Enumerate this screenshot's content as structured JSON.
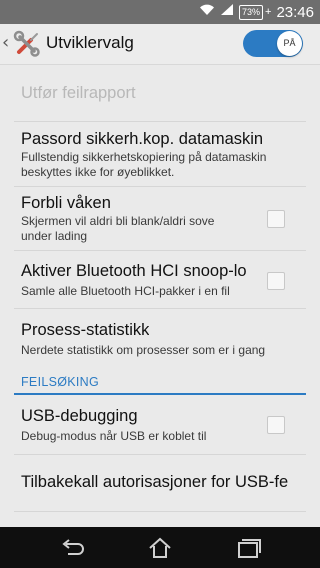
{
  "status_bar": {
    "battery": "73%",
    "time": "23:46"
  },
  "action_bar": {
    "title": "Utviklervalg",
    "toggle_label": "PÅ"
  },
  "items": [
    {
      "title": "Utfør feilrapport",
      "enabled": false
    },
    {
      "title": "Passord sikkerh.kop. datamaskin",
      "subtitle": "Fullstendig sikkerhetskopiering på datamaskin beskyttes ikke for øyeblikket."
    },
    {
      "title": "Forbli våken",
      "subtitle": "Skjermen vil aldri bli blank/aldri sove under lading",
      "checked": false
    },
    {
      "title": "Aktiver Bluetooth HCI snoop-logg",
      "subtitle": "Samle alle Bluetooth HCI-pakker i en fil",
      "checked": false
    },
    {
      "title": "Prosess-statistikk",
      "subtitle": "Nerdete statistikk om prosesser som er i gang"
    },
    {
      "title": "USB-debugging",
      "subtitle": "Debug-modus når USB er koblet til",
      "checked": false
    },
    {
      "title": "Tilbakekall autorisasjoner for USB-feilsøking"
    }
  ],
  "section": {
    "header": "FEILSØKING"
  },
  "colors": {
    "accent": "#2c7bc3",
    "status_bar": "#6e6e6e",
    "nav_bar": "#0f0f0f",
    "background": "#eaeaea"
  },
  "icons": {
    "wifi": "wifi-icon",
    "signal": "signal-icon",
    "battery": "battery-icon",
    "app": "developer-tools-icon",
    "back": "back-icon",
    "home": "home-icon",
    "recents": "recents-icon"
  }
}
